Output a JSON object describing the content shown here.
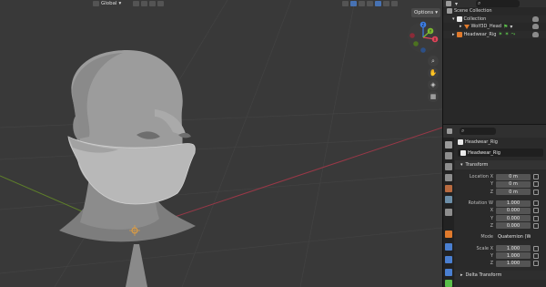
{
  "viewport": {
    "transform_orientation": "Global",
    "options_label": "Options",
    "gizmo_axes": {
      "x": "X",
      "y": "Y",
      "z": "Z"
    }
  },
  "outliner": {
    "rows": [
      {
        "label": "Scene Collection",
        "icon": "scene-collection-icon"
      },
      {
        "label": "Collection",
        "icon": "collection-icon"
      },
      {
        "label": "Wolf3D_Head",
        "icon": "mesh-icon"
      },
      {
        "label": "Headwear_Rig",
        "icon": "armature-icon"
      }
    ]
  },
  "properties": {
    "object_name": "Headwear_Rig",
    "name_field": "Headwear_Rig",
    "transform": {
      "title": "Transform",
      "location": [
        {
          "label": "Location X",
          "value": "0 m"
        },
        {
          "label": "Y",
          "value": "0 m"
        },
        {
          "label": "Z",
          "value": "0 m"
        }
      ],
      "rotation": [
        {
          "label": "Rotation W",
          "value": "1.000"
        },
        {
          "label": "X",
          "value": "0.000"
        },
        {
          "label": "Y",
          "value": "0.000"
        },
        {
          "label": "Z",
          "value": "0.000"
        }
      ],
      "mode": {
        "label": "Mode",
        "value": "Quaternion (WX…"
      },
      "scale": [
        {
          "label": "Scale X",
          "value": "1.000"
        },
        {
          "label": "Y",
          "value": "1.000"
        },
        {
          "label": "Z",
          "value": "1.000"
        }
      ]
    },
    "delta_transform_label": "Delta Transform"
  },
  "colors": {
    "viewport_bg": "#393939",
    "axis_x": "#e0455a",
    "axis_y": "#7dbb2f",
    "axis_z": "#3d7ee6",
    "active_tab": "#e07a2c"
  }
}
